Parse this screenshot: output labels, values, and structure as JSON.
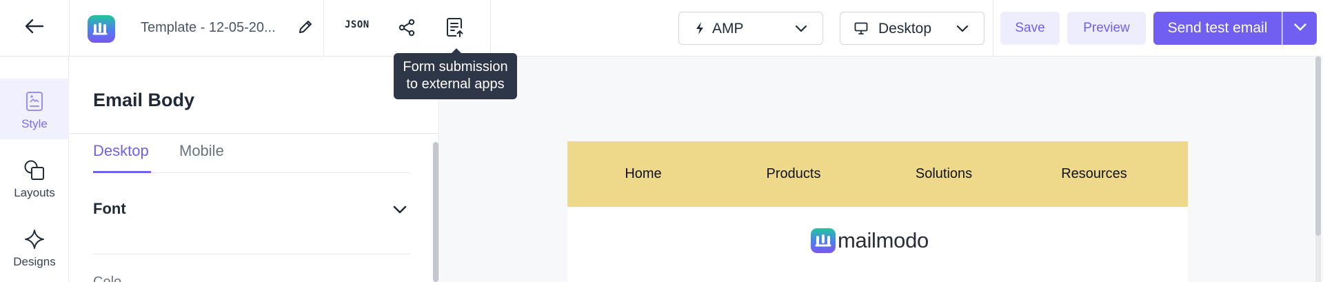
{
  "header": {
    "back_icon": "arrow-left-icon",
    "brand_icon": "mailmodo-logo-icon",
    "template_name": "Template - 12-05-20...",
    "edit_icon": "pencil-icon",
    "json_label": "JSON",
    "share_icon": "share-icon",
    "form_icon": "form-submission-icon",
    "format_select": {
      "icon": "lightning-icon",
      "value": "AMP"
    },
    "device_select": {
      "icon": "monitor-icon",
      "value": "Desktop"
    },
    "save_label": "Save",
    "preview_label": "Preview",
    "send_label": "Send test email",
    "send_caret_icon": "chevron-down-icon"
  },
  "tooltip": {
    "line1": "Form submission",
    "line2": "to external apps"
  },
  "rail": {
    "items": [
      {
        "label": "Style",
        "icon": "style-icon",
        "active": true
      },
      {
        "label": "Layouts",
        "icon": "layouts-icon",
        "active": false
      },
      {
        "label": "Designs",
        "icon": "sparkle-icon",
        "active": false
      }
    ]
  },
  "panel": {
    "title": "Email Body",
    "tabs": [
      {
        "label": "Desktop",
        "active": true
      },
      {
        "label": "Mobile",
        "active": false
      }
    ],
    "sections": [
      {
        "label": "Font",
        "expanded": false
      }
    ],
    "next_section_partial": "Colo"
  },
  "email_preview": {
    "nav_links": [
      "Home",
      "Products",
      "Solutions",
      "Resources"
    ],
    "brand": "mailmodo"
  },
  "colors": {
    "accent": "#705ff0",
    "accent_soft": "#eeedfd",
    "tooltip_bg": "#2d3748",
    "nav_band": "#eed98a",
    "canvas_bg": "#f7f8fa"
  }
}
